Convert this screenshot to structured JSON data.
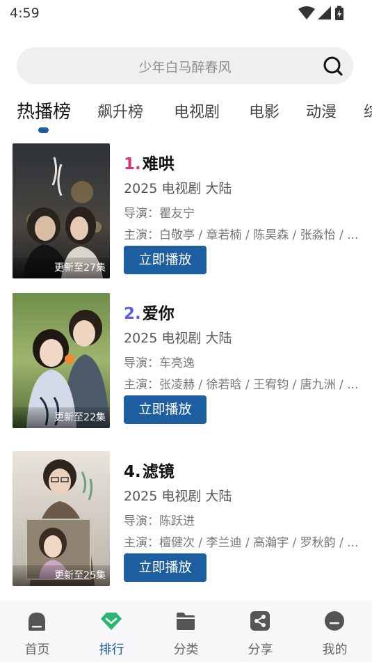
{
  "status_bar": {
    "time": "4:59"
  },
  "search": {
    "placeholder": "少年白马醉春风"
  },
  "tabs": [
    {
      "label": "热播榜",
      "active": true
    },
    {
      "label": "飙升榜"
    },
    {
      "label": "电视剧"
    },
    {
      "label": "电影"
    },
    {
      "label": "动漫"
    },
    {
      "label": "综"
    }
  ],
  "items": [
    {
      "rank": "1.",
      "rank_color": "#d6337a",
      "title": "难哄",
      "year": "2025",
      "type": "电视剧",
      "region": "大陆",
      "director": "导演：瞿友宁",
      "cast": "主演：白敬亭 / 章若楠 / 陈昊森 / 张淼怡 / ...",
      "update": "更新至27集",
      "play_label": "立即播放"
    },
    {
      "rank": "2.",
      "rank_color": "#5b5fe0",
      "title": "爱你",
      "year": "2025",
      "type": "电视剧",
      "region": "大陆",
      "director": "导演：车亮逸",
      "cast": "主演：张凌赫 / 徐若晗 / 王宥钧 / 唐九洲 / ...",
      "update": "更新至22集",
      "play_label": "立即播放"
    },
    {
      "rank": "4.",
      "rank_color": "#111111",
      "title": "滤镜",
      "year": "2025",
      "type": "电视剧",
      "region": "大陆",
      "director": "导演：陈跃进",
      "cast": "主演：檀健次 / 李兰迪 / 高瀚宇 / 罗秋韵 / ...",
      "update": "更新至25集",
      "play_label": "立即播放"
    }
  ],
  "bottom_nav": [
    {
      "label": "首页",
      "icon": "home-icon"
    },
    {
      "label": "排行",
      "icon": "ranking-icon",
      "active": true
    },
    {
      "label": "分类",
      "icon": "folder-icon"
    },
    {
      "label": "分享",
      "icon": "share-icon"
    },
    {
      "label": "我的",
      "icon": "profile-icon"
    }
  ],
  "colors": {
    "accent": "#1d5fa0",
    "active_nav_icon": "#2ab673"
  }
}
